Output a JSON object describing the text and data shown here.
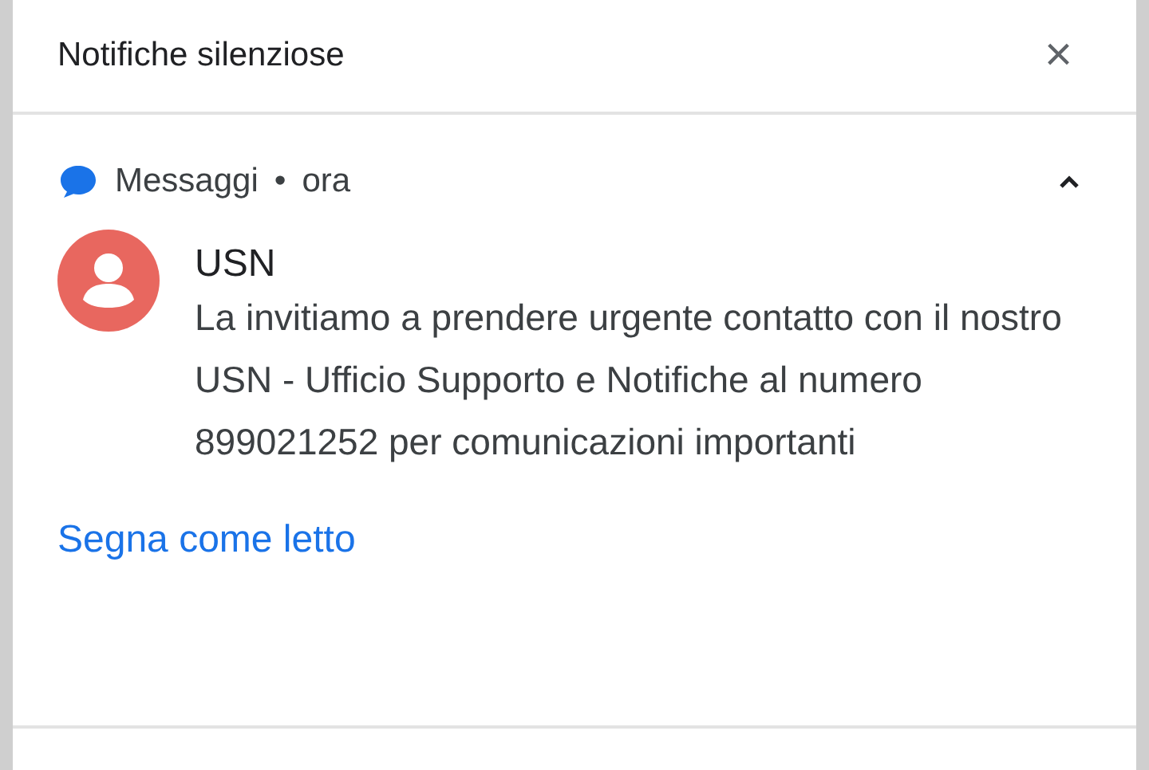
{
  "header": {
    "title": "Notifiche silenziose",
    "close": "×"
  },
  "notification": {
    "app": "Messaggi",
    "separator": "•",
    "time": "ora",
    "expanded": true,
    "sender": "USN",
    "message": "La invitiamo a prendere urgente contatto con il nostro USN - Ufficio Supporto e Notifiche al numero 899021252 per comunicazioni importanti",
    "action": "Segna come letto"
  }
}
